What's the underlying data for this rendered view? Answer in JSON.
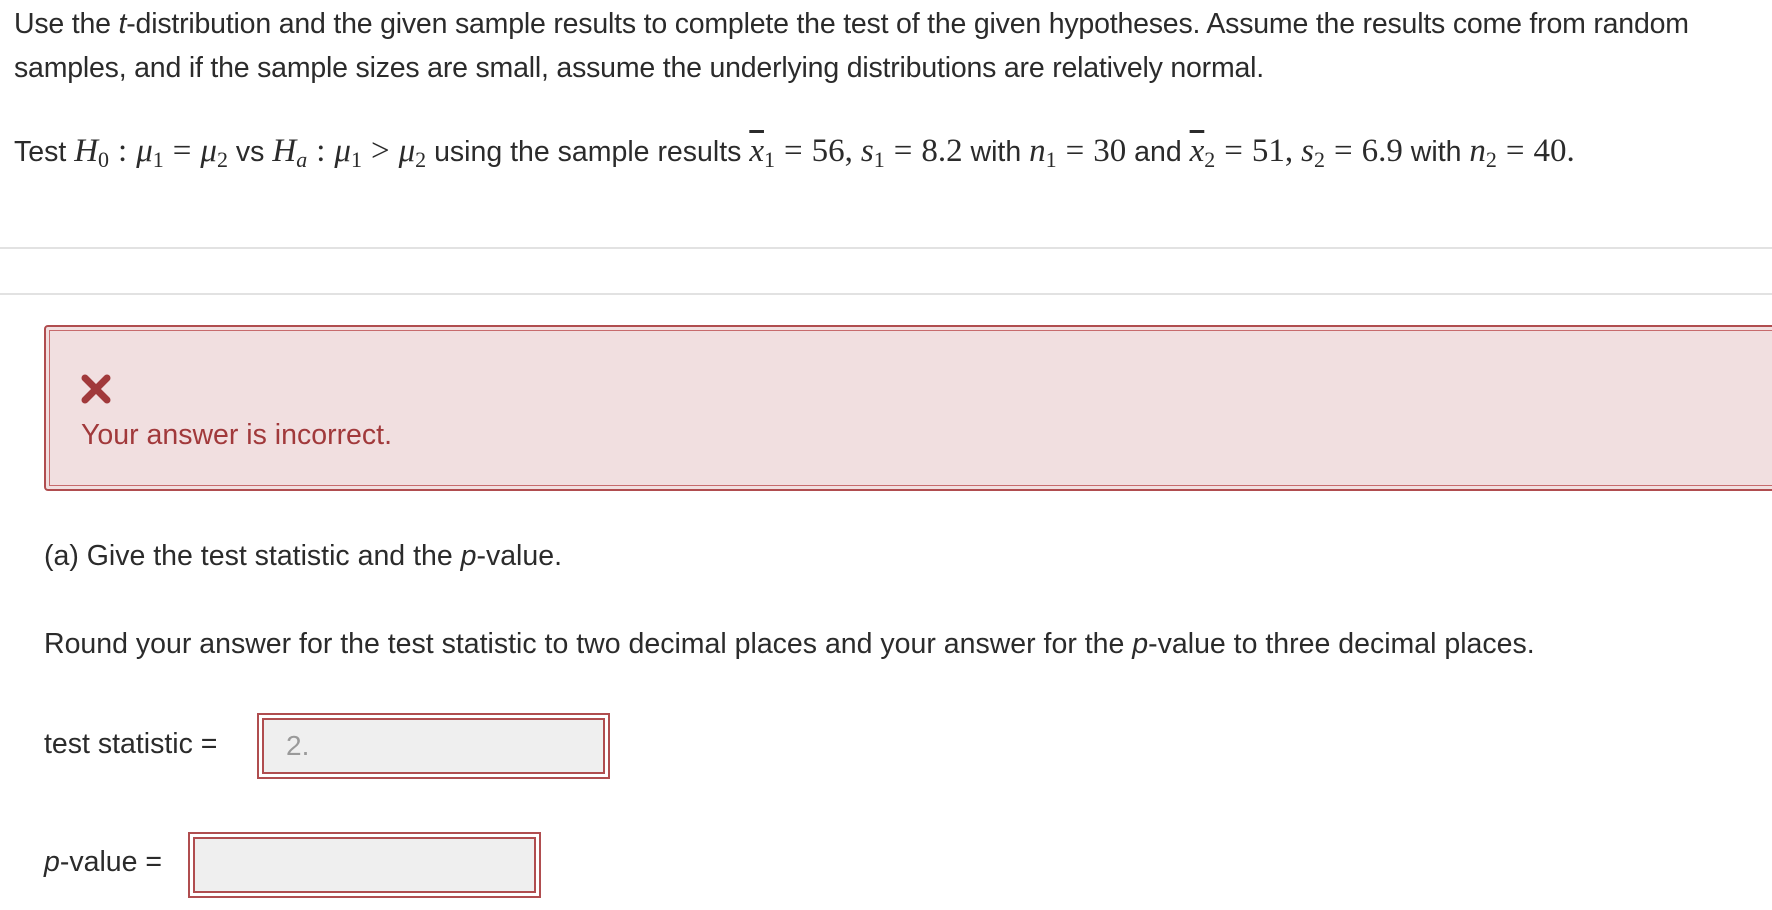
{
  "intro": {
    "part1": "Use the ",
    "t_word": "t",
    "part2": "-distribution and the given sample results to complete the test of the given hypotheses. Assume the results come from random samples, and if the sample sizes are small, assume the underlying distributions are relatively normal."
  },
  "hypothesis": {
    "test_word": "Test",
    "h0": "H",
    "h0_sub": "0",
    "colon": ":",
    "mu": "μ",
    "sub1": "1",
    "sub2": "2",
    "equals": "=",
    "vs_word": "vs",
    "ha": "H",
    "ha_sub": "a",
    "greater": ">",
    "using_text": "using the sample results",
    "xbar": "x",
    "x1_value": "56,",
    "s": "s",
    "s1_value": "8.2",
    "with_word": "with",
    "n": "n",
    "n1_value": "30",
    "and_word": "and",
    "x2_value": "51,",
    "s2_value": "6.9",
    "n2_value": "40."
  },
  "alert": {
    "icon": "close-icon",
    "message": "Your answer is incorrect.",
    "color": "#a1393b",
    "background": "#f1dfe0",
    "border": "#b04d4f"
  },
  "part_a": {
    "title": "(a) Give the test statistic and the p-value.",
    "title_prefix": "(a) Give the test statistic and the ",
    "p_letter": "p",
    "title_suffix": "-value.",
    "instruction_prefix": "Round your answer for the test statistic to two decimal places and your answer for the ",
    "instruction_suffix": "-value to three decimal places."
  },
  "fields": {
    "test_statistic_label": "test statistic =",
    "test_statistic_value": "2.",
    "p_value_label_suffix": "-value =",
    "p_value_value": ""
  }
}
